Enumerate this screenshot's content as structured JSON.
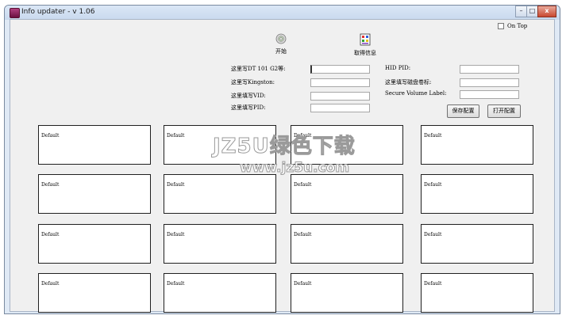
{
  "window": {
    "title": "Info updater - v 1.06",
    "controls": {
      "minimize": "–",
      "maximize": "□",
      "close": "x"
    }
  },
  "options": {
    "on_top_label": "On Top",
    "on_top_checked": false
  },
  "toolbar": {
    "start_label": "开始",
    "fetch_label": "取得信息",
    "start_icon": "disc-icon",
    "fetch_icon": "document-colors-icon"
  },
  "form": {
    "left": [
      {
        "label": "这里写DT 101 G2等:",
        "value": ""
      },
      {
        "label": "这里写Kingston:",
        "value": ""
      },
      {
        "label": "这里填写VID:",
        "value": ""
      },
      {
        "label": "这里填写PID:",
        "value": ""
      }
    ],
    "right": [
      {
        "label": "HID PID:",
        "value": ""
      },
      {
        "label": "这里填写磁盘卷标:",
        "value": ""
      },
      {
        "label": "Secure Volume Label:",
        "value": ""
      }
    ]
  },
  "buttons": {
    "save": "保存配置",
    "open": "打开配置"
  },
  "slots": [
    "Default",
    "Default",
    "Default",
    "Default",
    "Default",
    "Default",
    "Default",
    "Default",
    "Default",
    "Default",
    "Default",
    "Default",
    "Default",
    "Default",
    "Default",
    "Default"
  ],
  "watermark": {
    "line1": "JZ5U绿色下载",
    "line2": "www.jz5u.com"
  }
}
